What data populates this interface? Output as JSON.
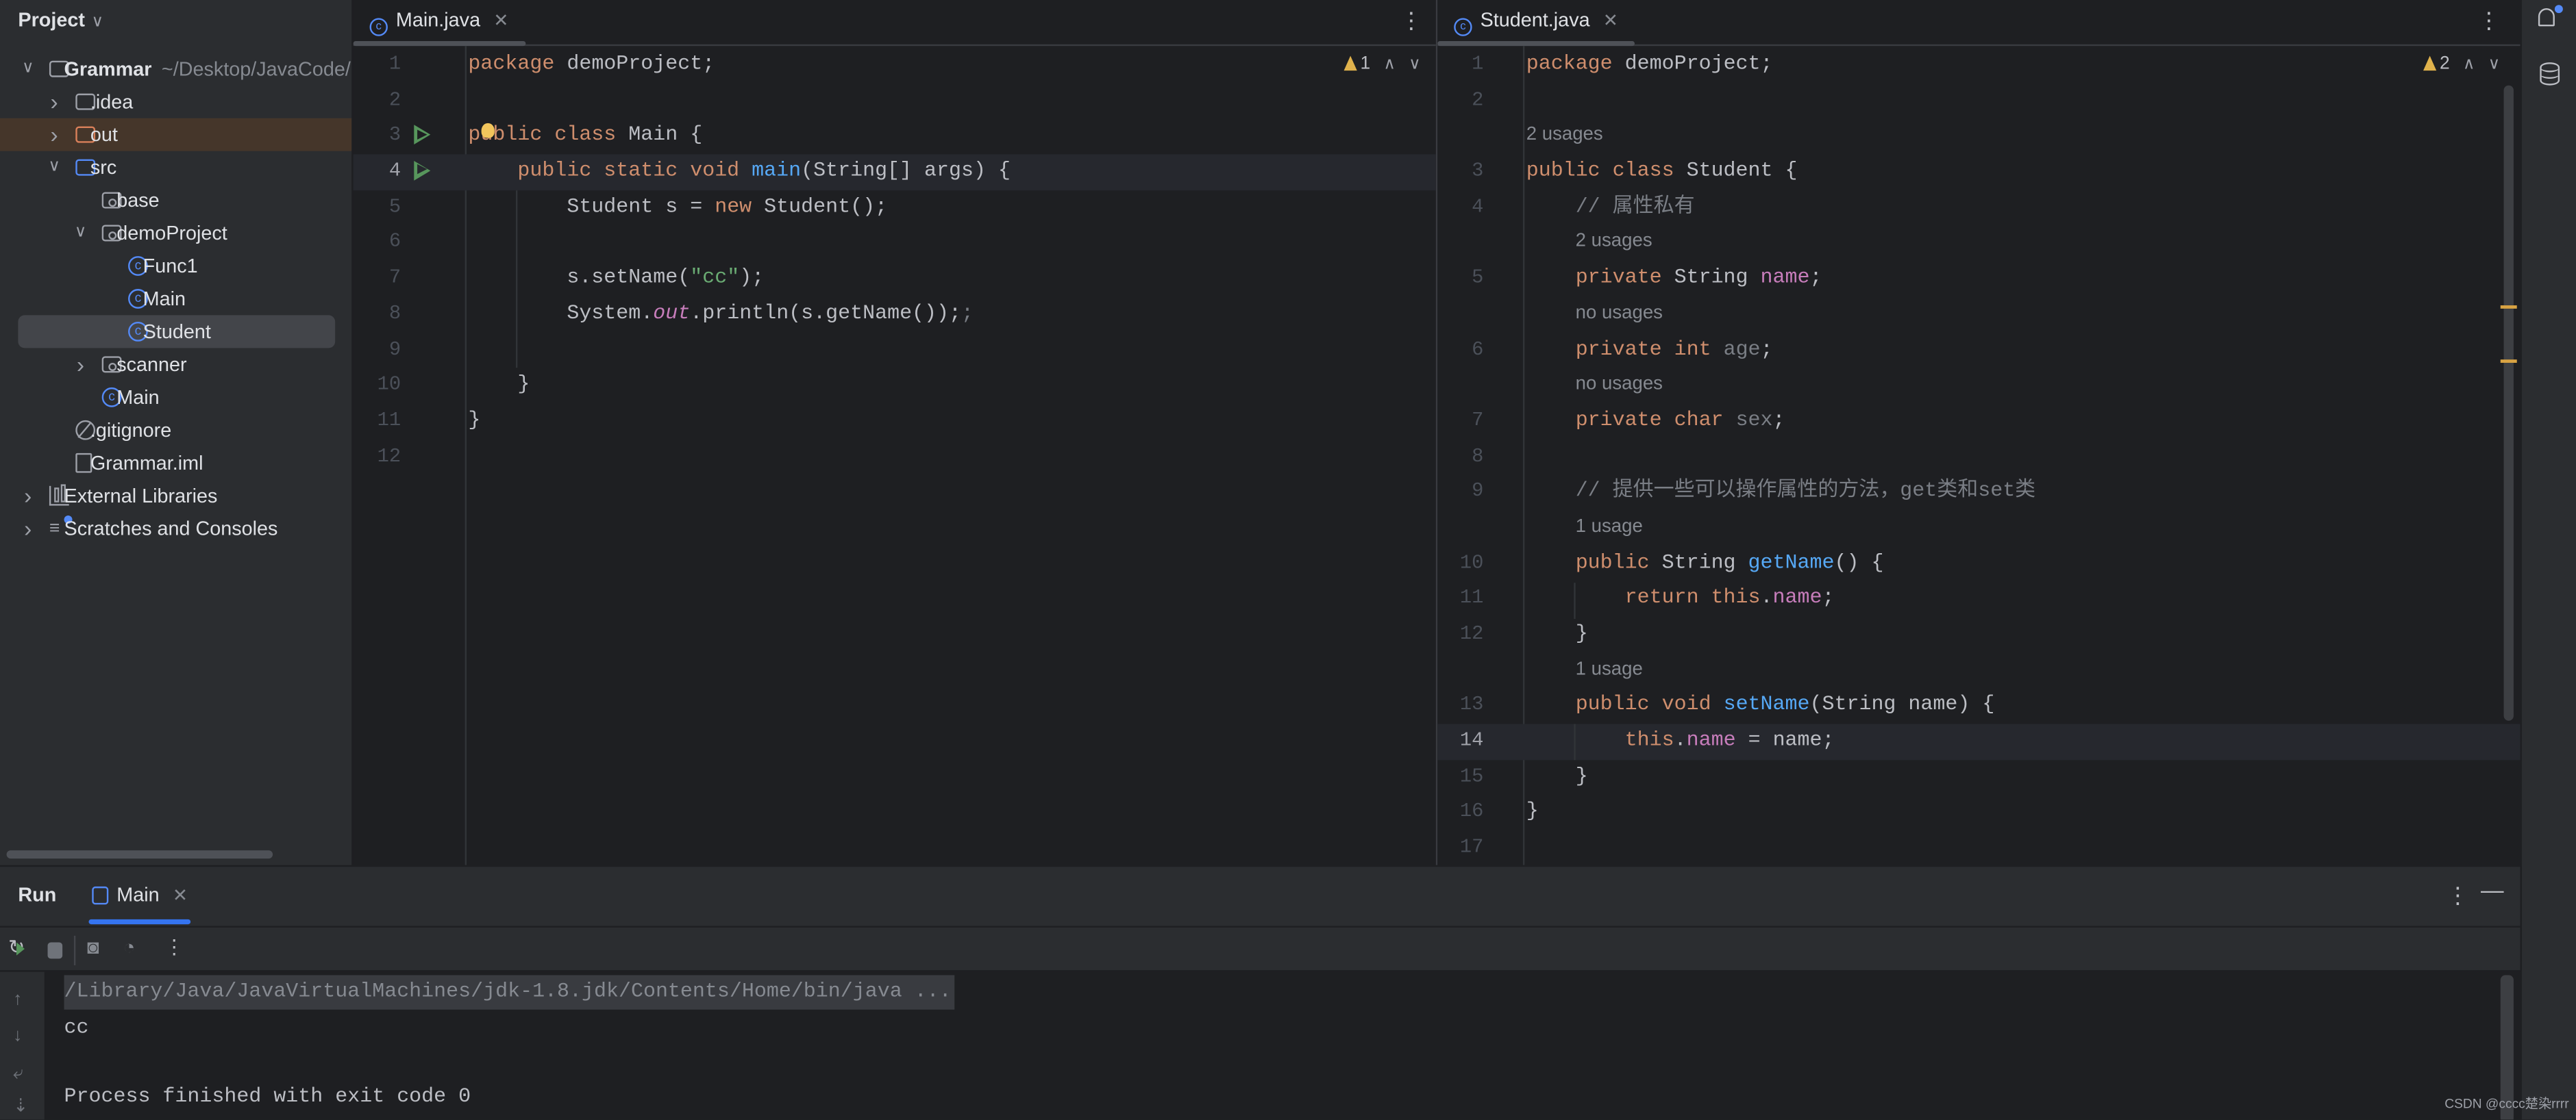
{
  "sidebar": {
    "title": "Project",
    "items": [
      {
        "label": "Grammar",
        "extra": "~/Desktop/JavaCode/(",
        "depth": 0,
        "arrow": "down",
        "icon": "project-folder-icon",
        "bold": true
      },
      {
        "label": ".idea",
        "depth": 1,
        "arrow": "right",
        "icon": "folder-icon"
      },
      {
        "label": "out",
        "depth": 1,
        "arrow": "right",
        "icon": "excluded-folder-icon",
        "state": "highlighted"
      },
      {
        "label": "src",
        "depth": 1,
        "arrow": "down",
        "icon": "source-folder-icon"
      },
      {
        "label": "base",
        "depth": 2,
        "arrow": null,
        "icon": "package-icon"
      },
      {
        "label": "demoProject",
        "depth": 2,
        "arrow": "down",
        "icon": "package-icon"
      },
      {
        "label": "Func1",
        "depth": 3,
        "arrow": null,
        "icon": "class-icon"
      },
      {
        "label": "Main",
        "depth": 3,
        "arrow": null,
        "icon": "class-icon"
      },
      {
        "label": "Student",
        "depth": 3,
        "arrow": null,
        "icon": "class-icon",
        "state": "selected"
      },
      {
        "label": "scanner",
        "depth": 2,
        "arrow": "right",
        "icon": "package-icon"
      },
      {
        "label": "Main",
        "depth": 2,
        "arrow": null,
        "icon": "class-icon"
      },
      {
        "label": ".gitignore",
        "depth": 1,
        "arrow": null,
        "icon": "gitignore-icon"
      },
      {
        "label": "Grammar.iml",
        "depth": 1,
        "arrow": null,
        "icon": "module-file-icon"
      },
      {
        "label": "External Libraries",
        "depth": 0,
        "arrow": "right",
        "icon": "library-icon"
      },
      {
        "label": "Scratches and Consoles",
        "depth": 0,
        "arrow": "right",
        "icon": "scratches-icon"
      }
    ]
  },
  "editor_main": {
    "tab": "Main.java",
    "warnings": "1",
    "current_line": 4,
    "run_lines": [
      3,
      4
    ],
    "lines": [
      {
        "n": 1,
        "t": [
          [
            "package",
            "kw"
          ],
          [
            " demoProject;",
            "id"
          ]
        ]
      },
      {
        "n": 2,
        "t": []
      },
      {
        "n": 3,
        "t": [
          [
            "public class",
            "kw"
          ],
          [
            " Main {",
            "id"
          ]
        ]
      },
      {
        "n": 4,
        "t": [
          [
            "    public static void ",
            "kw"
          ],
          [
            "main",
            "fn"
          ],
          [
            "(String[] args) {",
            "id"
          ]
        ]
      },
      {
        "n": 5,
        "t": [
          [
            "        Student s = ",
            "id"
          ],
          [
            "new",
            "kw"
          ],
          [
            " Student();",
            "id"
          ]
        ]
      },
      {
        "n": 6,
        "t": []
      },
      {
        "n": 7,
        "t": [
          [
            "        s.setName(",
            "id"
          ],
          [
            "\"cc\"",
            "str"
          ],
          [
            ");",
            "id"
          ]
        ]
      },
      {
        "n": 8,
        "t": [
          [
            "        System.",
            "id"
          ],
          [
            "out",
            "fldit"
          ],
          [
            ".println(s.getName());",
            "id"
          ],
          [
            ";",
            "dim"
          ]
        ]
      },
      {
        "n": 9,
        "t": []
      },
      {
        "n": 10,
        "t": [
          [
            "    }",
            "id"
          ]
        ]
      },
      {
        "n": 11,
        "t": [
          [
            "}",
            "id"
          ]
        ]
      },
      {
        "n": 12,
        "t": []
      }
    ]
  },
  "editor_student": {
    "tab": "Student.java",
    "warnings": "2",
    "current_line": 14,
    "lines": [
      {
        "n": 1,
        "t": [
          [
            "package",
            "kw"
          ],
          [
            " demoProject;",
            "id"
          ]
        ]
      },
      {
        "n": 2,
        "t": []
      },
      {
        "hint": "2 usages",
        "level": 0
      },
      {
        "n": 3,
        "t": [
          [
            "public class",
            "kw"
          ],
          [
            " Student {",
            "id"
          ]
        ]
      },
      {
        "n": 4,
        "t": [
          [
            "    // 属性私有",
            "cm"
          ]
        ]
      },
      {
        "hint": "2 usages",
        "level": 1
      },
      {
        "n": 5,
        "t": [
          [
            "    private",
            "kw"
          ],
          [
            " String ",
            "id"
          ],
          [
            "name",
            "fld"
          ],
          [
            ";",
            "id"
          ]
        ]
      },
      {
        "hint": "no usages",
        "level": 1
      },
      {
        "n": 6,
        "t": [
          [
            "    private int",
            "kw"
          ],
          [
            " age",
            "dim"
          ],
          [
            ";",
            "id"
          ]
        ]
      },
      {
        "hint": "no usages",
        "level": 1
      },
      {
        "n": 7,
        "t": [
          [
            "    private char",
            "kw"
          ],
          [
            " sex",
            "dim"
          ],
          [
            ";",
            "id"
          ]
        ]
      },
      {
        "n": 8,
        "t": []
      },
      {
        "n": 9,
        "t": [
          [
            "    // 提供一些可以操作属性的方法，get类和set类",
            "cm"
          ]
        ]
      },
      {
        "hint": "1 usage",
        "level": 1
      },
      {
        "n": 10,
        "t": [
          [
            "    public",
            "kw"
          ],
          [
            " String ",
            "id"
          ],
          [
            "getName",
            "fn"
          ],
          [
            "() {",
            "id"
          ]
        ]
      },
      {
        "n": 11,
        "t": [
          [
            "        return this",
            "kw"
          ],
          [
            ".",
            "id"
          ],
          [
            "name",
            "fld"
          ],
          [
            ";",
            "id"
          ]
        ]
      },
      {
        "n": 12,
        "t": [
          [
            "    }",
            "id"
          ]
        ]
      },
      {
        "hint": "1 usage",
        "level": 1
      },
      {
        "n": 13,
        "t": [
          [
            "    public void ",
            "kw"
          ],
          [
            "setName",
            "fn"
          ],
          [
            "(String name) {",
            "id"
          ]
        ]
      },
      {
        "n": 14,
        "t": [
          [
            "        this",
            "kw"
          ],
          [
            ".",
            "id"
          ],
          [
            "name",
            "fld"
          ],
          [
            " = name;",
            "id"
          ]
        ]
      },
      {
        "n": 15,
        "t": [
          [
            "    }",
            "id"
          ]
        ]
      },
      {
        "n": 16,
        "t": [
          [
            "}",
            "id"
          ]
        ]
      },
      {
        "n": 17,
        "t": []
      }
    ]
  },
  "run_panel": {
    "title": "Run",
    "tab": "Main",
    "console": [
      "/Library/Java/JavaVirtualMachines/jdk-1.8.jdk/Contents/Home/bin/java ...",
      "cc",
      "",
      "Process finished with exit code 0"
    ]
  },
  "icons": {
    "more": "⋮",
    "minimize": "—",
    "close": "×",
    "chevron_down": "⌄",
    "up": "⌃",
    "down": "⌄"
  },
  "colors": {
    "keyword": "#cf8e6d",
    "string": "#6aab73",
    "method": "#56a8f5",
    "field": "#c77dbb",
    "comment": "#7a7e85",
    "accent": "#3574f0"
  },
  "watermark": "CSDN @cccc楚染rrrr"
}
